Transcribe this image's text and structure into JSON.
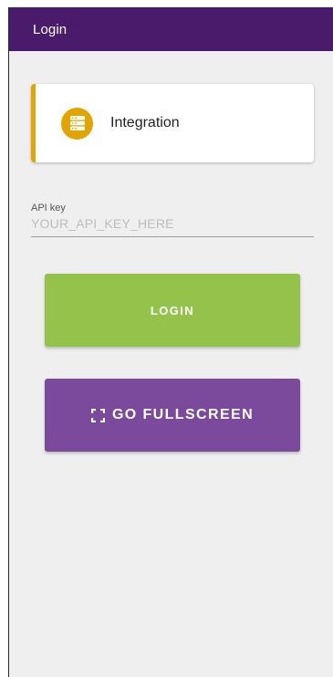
{
  "appbar": {
    "title": "Login",
    "color": "#4a1a6b"
  },
  "integration_card": {
    "label": "Integration",
    "icon": "server-icon",
    "accent_color": "#e3a400"
  },
  "api_key": {
    "label": "API key",
    "placeholder": "YOUR_API_KEY_HERE",
    "value": ""
  },
  "buttons": {
    "login_label": "LOGIN",
    "login_color": "#93c34a",
    "fullscreen_label": "GO FULLSCREEN",
    "fullscreen_icon": "fullscreen-icon",
    "fullscreen_color": "#7c4a9d"
  }
}
